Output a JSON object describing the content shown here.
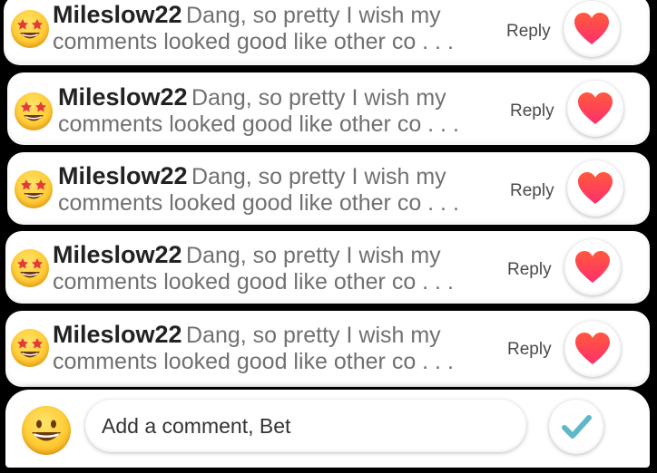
{
  "comments": [
    {
      "username": "Mileslow22",
      "text_line1": "Dang, so pretty I wish my",
      "text_line2": "comments looked good like other co . . .",
      "reply_label": "Reply",
      "avatar_icon": "star-struck-emoji-icon",
      "like_icon": "heart-icon"
    },
    {
      "username": "Mileslow22",
      "text_line1": "Dang, so pretty I wish my",
      "text_line2": "comments looked good like other co . . .",
      "reply_label": "Reply",
      "avatar_icon": "star-struck-emoji-icon",
      "like_icon": "heart-icon"
    },
    {
      "username": "Mileslow22",
      "text_line1": "Dang, so pretty I wish my",
      "text_line2": "comments looked good like other co . . .",
      "reply_label": "Reply",
      "avatar_icon": "star-struck-emoji-icon",
      "like_icon": "heart-icon"
    },
    {
      "username": "Mileslow22",
      "text_line1": "Dang, so pretty I wish my",
      "text_line2": "comments looked good like other co . . .",
      "reply_label": "Reply",
      "avatar_icon": "star-struck-emoji-icon",
      "like_icon": "heart-icon"
    },
    {
      "username": "Mileslow22",
      "text_line1": "Dang, so pretty I wish my",
      "text_line2": "comments looked good like other co . . .",
      "reply_label": "Reply",
      "avatar_icon": "star-struck-emoji-icon",
      "like_icon": "heart-icon"
    }
  ],
  "composer": {
    "placeholder": "Add a comment, Bet",
    "emoji_icon": "grinning-emoji-icon",
    "send_icon": "checkmark-icon"
  },
  "colors": {
    "heart_top": "#ff5a3d",
    "heart_bottom": "#ff2f6d",
    "checkmark": "#5fb8c8",
    "username": "#222222",
    "comment_text": "#707070"
  }
}
